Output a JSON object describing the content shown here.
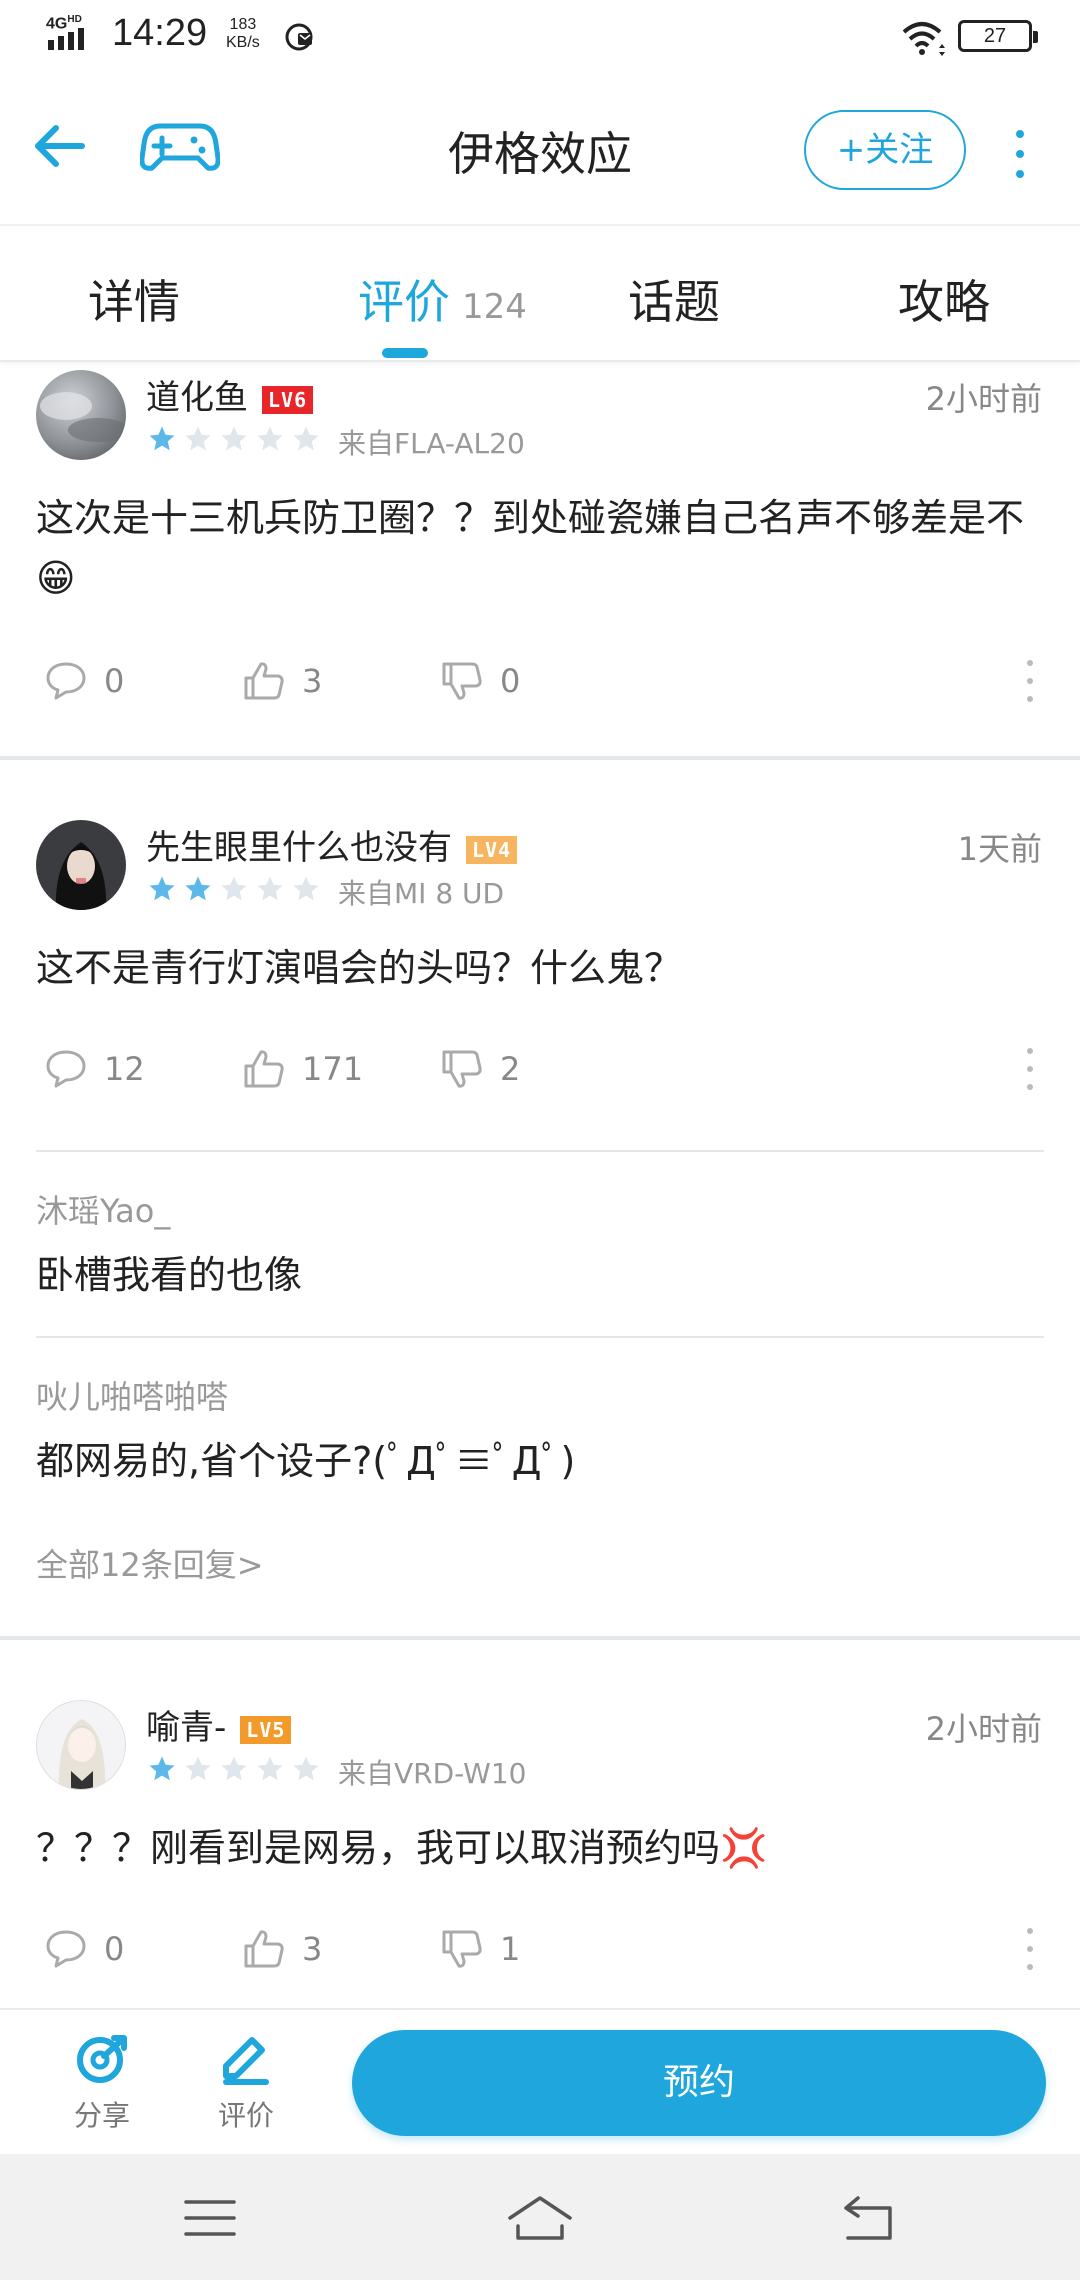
{
  "status_bar": {
    "network": "4G",
    "network_sup": "HD",
    "time": "14:29",
    "speed_value": "183",
    "speed_unit": "KB/s",
    "battery": "27"
  },
  "header": {
    "title": "伊格效应",
    "follow_label": "+关注"
  },
  "tabs": [
    {
      "label": "详情"
    },
    {
      "label": "评价",
      "count": "124",
      "active": true
    },
    {
      "label": "话题"
    },
    {
      "label": "攻略"
    }
  ],
  "reviews": [
    {
      "user": "道化鱼",
      "level": "LV6",
      "level_color": "#e8262a",
      "time": "2小时前",
      "rating": 1,
      "device": "来自FLA-AL20",
      "text": "这次是十三机兵防卫圈？？到处碰瓷嫌自己名声不够差是不😁",
      "comments": "0",
      "likes": "3",
      "dislikes": "0"
    },
    {
      "user": "先生眼里什么也没有",
      "level": "LV4",
      "level_color": "#f6b55e",
      "time": "1天前",
      "rating": 2,
      "device": "来自MI 8 UD",
      "text": "这不是青行灯演唱会的头吗？什么鬼？",
      "comments": "12",
      "likes": "171",
      "dislikes": "2",
      "replies": [
        {
          "user": "沐瑶Yao_",
          "text": "卧槽我看的也像"
        },
        {
          "user": "吙儿啪嗒啪嗒",
          "text": "都网易的,省个设子?(ﾟДﾟ≡ﾟДﾟ)"
        }
      ],
      "all_replies": "全部12条回复>"
    },
    {
      "user": "喻青-",
      "level": "LV5",
      "level_color": "#f39b2a",
      "time": "2小时前",
      "rating": 1,
      "device": "来自VRD-W10",
      "text": "？？？刚看到是网易，我可以取消预约吗💢",
      "comments": "0",
      "likes": "3",
      "dislikes": "1"
    }
  ],
  "bottom_bar": {
    "share_label": "分享",
    "review_label": "评价",
    "reserve_label": "预约"
  },
  "colors": {
    "accent": "#1fa6dd",
    "star_on": "#5bb8e8",
    "star_off": "#dfe6ec"
  },
  "icons": [
    "back-arrow-icon",
    "gamepad-icon",
    "more-vertical-icon",
    "comment-icon",
    "thumbs-up-icon",
    "thumbs-down-icon",
    "share-icon",
    "edit-icon",
    "menu-icon",
    "home-icon",
    "return-icon"
  ]
}
